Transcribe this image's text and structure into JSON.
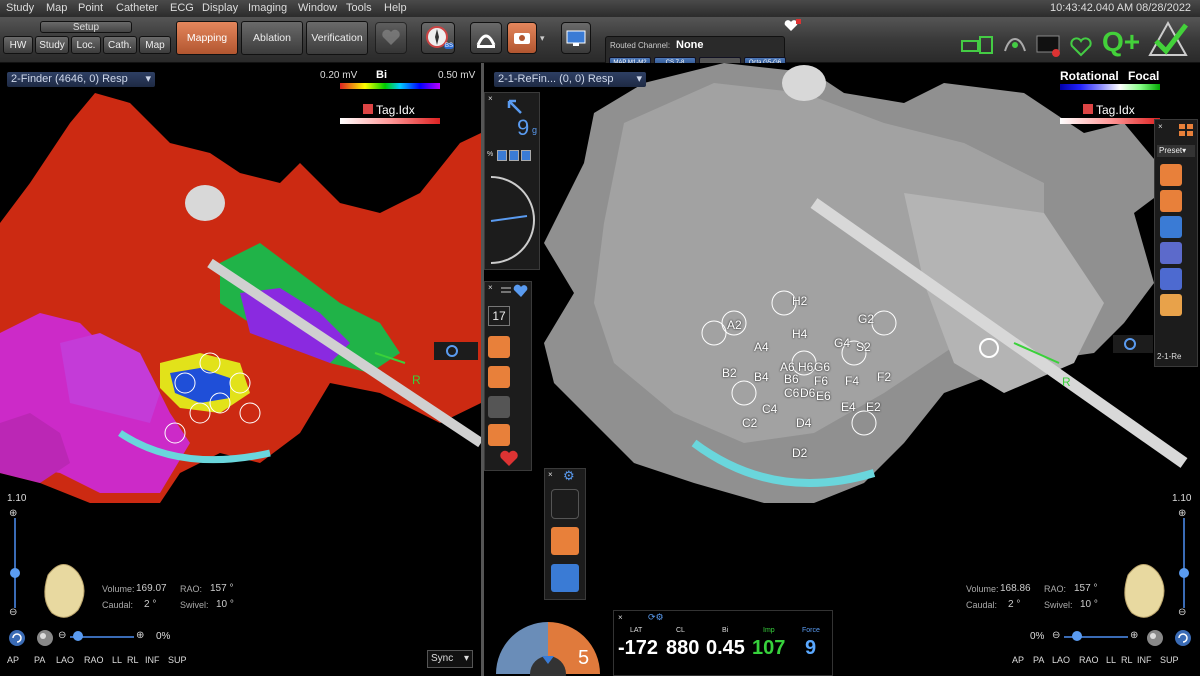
{
  "menu": [
    "Study",
    "Map",
    "Point",
    "Catheter",
    "ECG",
    "Display",
    "Imaging",
    "Window",
    "Tools",
    "Help"
  ],
  "clock": "10:43:42.040 AM",
  "date": "08/28/2022",
  "toolbar": {
    "setup_label": "Setup",
    "setup_buttons": [
      "HW",
      "Study",
      "Loc.",
      "Cath.",
      "Map"
    ],
    "mode_buttons": [
      "Mapping",
      "Ablation",
      "Verification"
    ],
    "bs_label": "BS",
    "routed_channel_label": "Routed Channel:",
    "routed_channel_value": "None",
    "channels": [
      "MAP M1-M2",
      "CS 7-8",
      "",
      "Octa G5-G6"
    ]
  },
  "left_pane": {
    "title": "2-Finder (4646, 0) Resp",
    "scale_min": "0.20 mV",
    "scale_mode": "Bi",
    "scale_max": "0.50 mV",
    "tag_label": "Tag.Idx",
    "zoom_label": "1.10",
    "volume_label": "Volume:",
    "volume_value": "169.07",
    "rao_label": "RAO:",
    "rao_value": "157 °",
    "caudal_label": "Caudal:",
    "caudal_value": "2 °",
    "swivel_label": "Swivel:",
    "swivel_value": "10 °",
    "opacity": "0%",
    "views": [
      "AP",
      "PA",
      "LAO",
      "RAO",
      "LL",
      "RL",
      "INF",
      "SUP"
    ],
    "sync": "Sync",
    "r_label": "R"
  },
  "right_pane": {
    "title": "2-1-ReFin... (0, 0) Resp",
    "rotational": "Rotational",
    "focal": "Focal",
    "tag_label": "Tag.Idx",
    "preset": "Preset",
    "preset_footer": "2-1-Re",
    "zoom_label": "1.10",
    "volume_label": "Volume:",
    "volume_value": "168.86",
    "rao_label": "RAO:",
    "rao_value": "157 °",
    "caudal_label": "Caudal:",
    "caudal_value": "2 °",
    "swivel_label": "Swivel:",
    "swivel_value": "10 °",
    "opacity": "0%",
    "views": [
      "AP",
      "PA",
      "LAO",
      "RAO",
      "LL",
      "RL",
      "INF",
      "SUP"
    ],
    "r_label": "R",
    "electrodes": [
      "H2",
      "A2",
      "G2",
      "H4",
      "A4",
      "G4",
      "S2",
      "A6",
      "H6",
      "G6",
      "B2",
      "B4",
      "B6",
      "F6",
      "F4",
      "F2",
      "C6",
      "D6",
      "E6",
      "E4",
      "E2",
      "C4",
      "C2",
      "D4",
      "D2"
    ]
  },
  "center": {
    "force_value": "9",
    "force_unit": "g",
    "count": "17",
    "ring_value": "5"
  },
  "readout": {
    "labels": [
      "LAT",
      "CL",
      "Bi",
      "Imp",
      "Force"
    ],
    "values": [
      "-172",
      "880",
      "0.45",
      "107",
      "9"
    ],
    "colors": [
      "#ffffff",
      "#ffffff",
      "#ffffff",
      "#37d13c",
      "#5aa8ff"
    ]
  }
}
